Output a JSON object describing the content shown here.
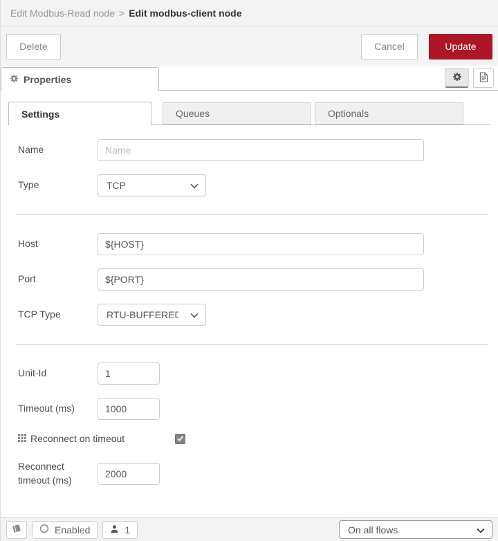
{
  "breadcrumb": {
    "parent": "Edit Modbus-Read node",
    "separator": ">",
    "current": "Edit modbus-client node"
  },
  "toolbar": {
    "delete_label": "Delete",
    "cancel_label": "Cancel",
    "update_label": "Update"
  },
  "properties_bar": {
    "title": "Properties",
    "icons": [
      "gear-icon",
      "file-document-icon"
    ]
  },
  "tabs": [
    {
      "label": "Settings",
      "active": true
    },
    {
      "label": "Queues",
      "active": false
    },
    {
      "label": "Optionals",
      "active": false
    }
  ],
  "form": {
    "name": {
      "label": "Name",
      "placeholder": "Name",
      "value": ""
    },
    "type": {
      "label": "Type",
      "value": "TCP"
    },
    "host": {
      "label": "Host",
      "value": "${HOST}"
    },
    "port": {
      "label": "Port",
      "value": "${PORT}"
    },
    "tcp_type": {
      "label": "TCP Type",
      "value": "RTU-BUFFERED"
    },
    "unit_id": {
      "label": "Unit-Id",
      "value": "1"
    },
    "timeout": {
      "label": "Timeout (ms)",
      "value": "1000"
    },
    "reconnect_on_timeout": {
      "label": "Reconnect on timeout",
      "checked": true,
      "icon": "grid-icon"
    },
    "reconnect_timeout": {
      "label": "Reconnect timeout (ms)",
      "value": "2000"
    }
  },
  "footer": {
    "book_icon": "book-icon",
    "enabled_label": "Enabled",
    "instance_count": "1",
    "scope_value": "On all flows"
  },
  "colors": {
    "accent_red": "#AD1625",
    "toolbar_bg": "#f3f3f3",
    "tab_inactive_bg": "#f0f0f0",
    "checkbox_bg": "#848484"
  }
}
